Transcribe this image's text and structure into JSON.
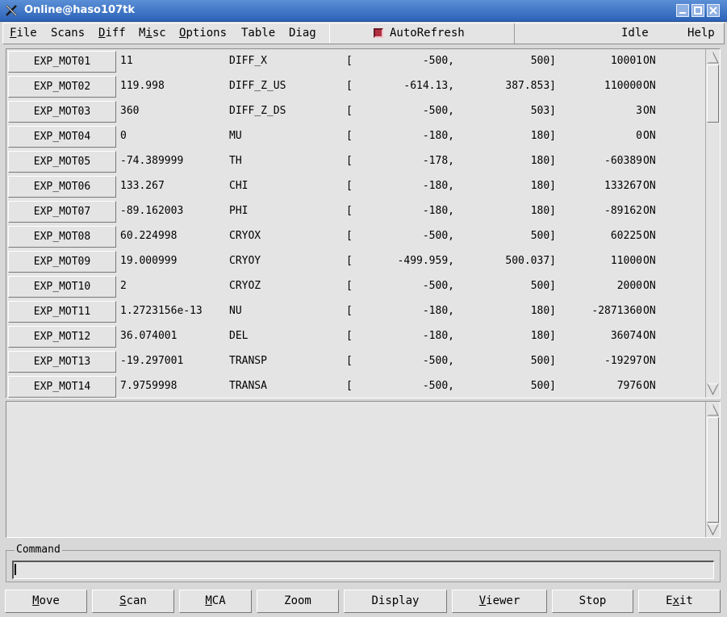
{
  "window": {
    "title": "Online@haso107tk"
  },
  "menu": {
    "items": [
      {
        "pre": "",
        "ul": "F",
        "post": "ile"
      },
      {
        "pre": "",
        "ul": "",
        "post": "Scans"
      },
      {
        "pre": "",
        "ul": "D",
        "post": "iff"
      },
      {
        "pre": "M",
        "ul": "i",
        "post": "sc"
      },
      {
        "pre": "",
        "ul": "O",
        "post": "ptions"
      },
      {
        "pre": "",
        "ul": "",
        "post": "Table"
      },
      {
        "pre": "",
        "ul": "",
        "post": "Diag"
      }
    ],
    "autorefresh_label": "AutoRefresh",
    "status": "Idle",
    "help": {
      "ul": "H",
      "post": "elp"
    }
  },
  "motors": [
    {
      "label": "EXP_MOT01",
      "position": "11",
      "name": "DIFF_X",
      "bracket": "[",
      "min": "-500,",
      "max": "500]",
      "steps": "10001",
      "state": "ON"
    },
    {
      "label": "EXP_MOT02",
      "position": "119.998",
      "name": "DIFF_Z_US",
      "bracket": "[",
      "min": "-614.13,",
      "max": "387.853]",
      "steps": "110000",
      "state": "ON"
    },
    {
      "label": "EXP_MOT03",
      "position": "360",
      "name": "DIFF_Z_DS",
      "bracket": "[",
      "min": "-500,",
      "max": "503]",
      "steps": "3",
      "state": "ON"
    },
    {
      "label": "EXP_MOT04",
      "position": "0",
      "name": "MU",
      "bracket": "[",
      "min": "-180,",
      "max": "180]",
      "steps": "0",
      "state": "ON"
    },
    {
      "label": "EXP_MOT05",
      "position": "-74.389999",
      "name": "TH",
      "bracket": "[",
      "min": "-178,",
      "max": "180]",
      "steps": "-60389",
      "state": "ON"
    },
    {
      "label": "EXP_MOT06",
      "position": "133.267",
      "name": "CHI",
      "bracket": "[",
      "min": "-180,",
      "max": "180]",
      "steps": "133267",
      "state": "ON"
    },
    {
      "label": "EXP_MOT07",
      "position": "-89.162003",
      "name": "PHI",
      "bracket": "[",
      "min": "-180,",
      "max": "180]",
      "steps": "-89162",
      "state": "ON"
    },
    {
      "label": "EXP_MOT08",
      "position": "60.224998",
      "name": "CRYOX",
      "bracket": "[",
      "min": "-500,",
      "max": "500]",
      "steps": "60225",
      "state": "ON"
    },
    {
      "label": "EXP_MOT09",
      "position": "19.000999",
      "name": "CRYOY",
      "bracket": "[",
      "min": "-499.959,",
      "max": "500.037]",
      "steps": "11000",
      "state": "ON"
    },
    {
      "label": "EXP_MOT10",
      "position": "2",
      "name": "CRYOZ",
      "bracket": "[",
      "min": "-500,",
      "max": "500]",
      "steps": "2000",
      "state": "ON"
    },
    {
      "label": "EXP_MOT11",
      "position": "1.2723156e-13",
      "name": "NU",
      "bracket": "[",
      "min": "-180,",
      "max": "180]",
      "steps": "-2871360",
      "state": "ON"
    },
    {
      "label": "EXP_MOT12",
      "position": "36.074001",
      "name": "DEL",
      "bracket": "[",
      "min": "-180,",
      "max": "180]",
      "steps": "36074",
      "state": "ON"
    },
    {
      "label": "EXP_MOT13",
      "position": "-19.297001",
      "name": "TRANSP",
      "bracket": "[",
      "min": "-500,",
      "max": "500]",
      "steps": "-19297",
      "state": "ON"
    },
    {
      "label": "EXP_MOT14",
      "position": "7.9759998",
      "name": "TRANSA",
      "bracket": "[",
      "min": "-500,",
      "max": "500]",
      "steps": "7976",
      "state": "ON"
    }
  ],
  "command": {
    "label": "Command",
    "value": ""
  },
  "buttons": [
    {
      "pre": "",
      "ul": "M",
      "post": "ove"
    },
    {
      "pre": "",
      "ul": "S",
      "post": "can"
    },
    {
      "pre": "",
      "ul": "M",
      "post": "CA"
    },
    {
      "pre": "",
      "ul": "",
      "post": "Zoom"
    },
    {
      "pre": "",
      "ul": "",
      "post": "Display"
    },
    {
      "pre": "",
      "ul": "V",
      "post": "iewer"
    },
    {
      "pre": "",
      "ul": "",
      "post": "Stop"
    },
    {
      "pre": "E",
      "ul": "x",
      "post": "it"
    }
  ],
  "colors": {
    "titlebar": "#2c63b8",
    "panel": "#e4e4e4",
    "autorefresh_check": "#b03040"
  }
}
